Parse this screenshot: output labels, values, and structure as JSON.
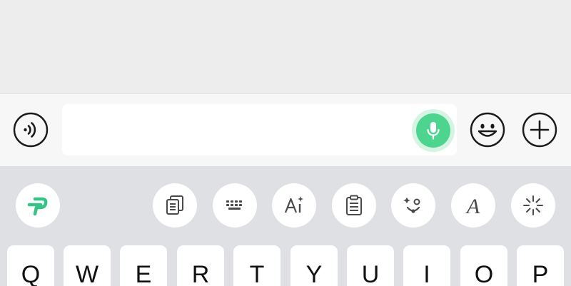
{
  "input_bar": {
    "text_value": "",
    "placeholder": ""
  },
  "icons": {
    "voice": "voice-wave-icon",
    "mic": "microphone-icon",
    "emoji": "smiley-face-icon",
    "plus": "plus-circle-icon",
    "logo": "green-p-logo-icon",
    "toolbar": [
      "copy-document-icon",
      "keyboard-icon",
      "ai-text-icon",
      "clipboard-icon",
      "face-emoticon-icon",
      "font-style-icon",
      "sparkle-icon"
    ]
  },
  "toolbar": {
    "font_glyph": "A"
  },
  "colors": {
    "accent_green": "#4dd48e",
    "mic_halo": "#d5f4e3",
    "keyboard_bg": "#dfe0e4"
  },
  "keyboard": {
    "row1": [
      "Q",
      "W",
      "E",
      "R",
      "T",
      "Y",
      "U",
      "I",
      "O",
      "P"
    ]
  }
}
